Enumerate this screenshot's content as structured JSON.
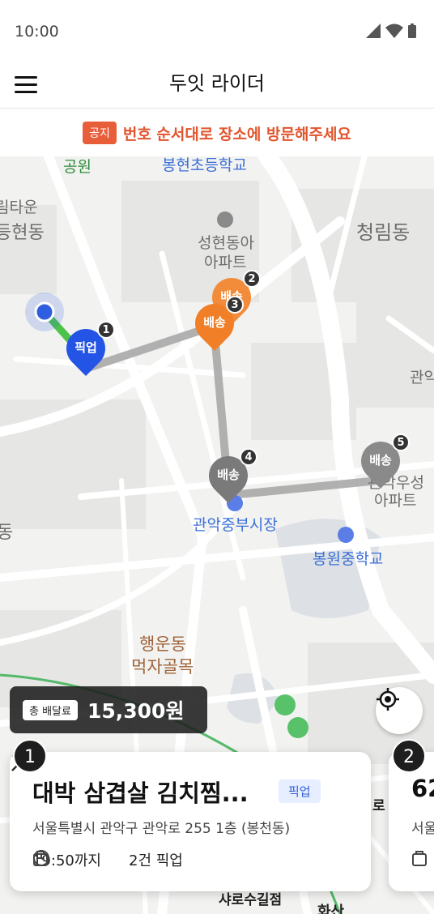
{
  "status_bar": {
    "time": "10:00"
  },
  "header": {
    "title": "두잇 라이더"
  },
  "notice": {
    "badge": "공지",
    "text": "번호 순서대로 장소에 방문해주세요"
  },
  "map": {
    "labels": {
      "park": "공원",
      "bonghyeon_school": "봉현초등학교",
      "hilltown": "림타운",
      "dong_left": "등현동",
      "seonghyeon_apt_1": "성현동아",
      "seonghyeon_apt_2": "아파트",
      "cheongnim": "청림동",
      "gwanak_right": "관악",
      "gwanak_market": "관악중부시장",
      "bongwon_school": "봉원중학교",
      "gwanak_apt_1": "관악우성",
      "gwanak_apt_2": "아파트",
      "dong_left2": "동",
      "haengun_1": "행운동",
      "haengun_2": "먹자골목",
      "sharosu": "샤로수길점",
      "ro": "로",
      "hwasan": "화산"
    },
    "pins": [
      {
        "label": "픽업",
        "num": "1",
        "color": "#2454e6"
      },
      {
        "label": "배송",
        "num": "2",
        "color": "#f28c3a"
      },
      {
        "label": "배송",
        "num": "3",
        "color": "#f07f27"
      },
      {
        "label": "배송",
        "num": "4",
        "color": "#7a7a7a"
      },
      {
        "label": "배송",
        "num": "5",
        "color": "#8a8a8a"
      }
    ]
  },
  "fee": {
    "label": "총 배달료",
    "amount": "15,300원"
  },
  "cards": [
    {
      "num": "1",
      "title": "대박 삼겹살 김치찜...",
      "tag": "픽업",
      "address": "서울특별시 관악구 관악로 255 1층 (봉천동)",
      "deadline": "19:50까지",
      "count": "2건 픽업"
    },
    {
      "num": "2",
      "title": "62",
      "address": "서울"
    }
  ]
}
